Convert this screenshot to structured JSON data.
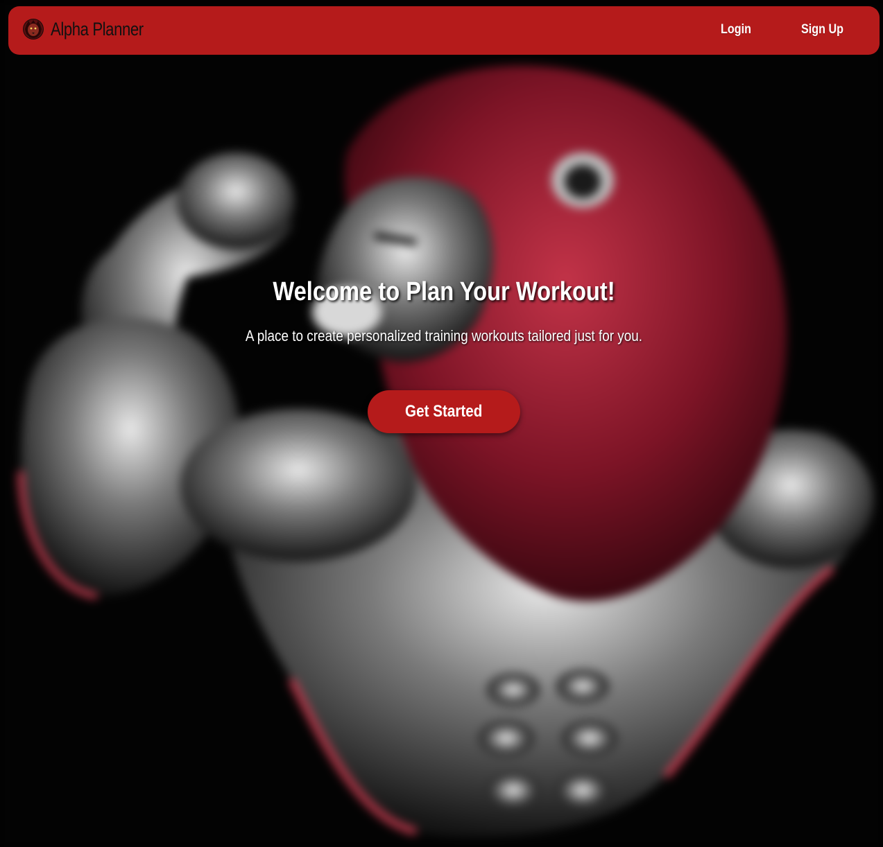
{
  "navbar": {
    "brand_name": "Alpha Planner",
    "logo_icon": "lion-head-icon",
    "login_label": "Login",
    "signup_label": "Sign Up",
    "background_color": "#b51b1b"
  },
  "hero": {
    "title": "Welcome to Plan Your Workout!",
    "subtitle": "A place to create personalized training workouts tailored just for you.",
    "cta_label": "Get Started",
    "background_image": "muscular-lion-flexing-illustration",
    "accent_color": "#b51b1b"
  }
}
